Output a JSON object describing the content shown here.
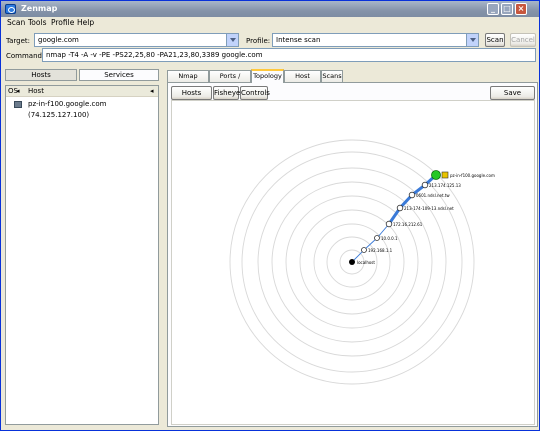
{
  "window": {
    "title": "Zenmap"
  },
  "menu": {
    "scan": "Scan",
    "tools": "Tools",
    "profile": "Profile",
    "help": "Help"
  },
  "target": {
    "label": "Target:",
    "value": "google.com"
  },
  "profile": {
    "label": "Profile:",
    "value": "Intense scan"
  },
  "buttons": {
    "scan": "Scan",
    "cancel": "Cancel"
  },
  "command": {
    "label": "Command:",
    "value": "nmap -T4 -A -v -PE -PS22,25,80 -PA21,23,80,3389 google.com"
  },
  "left_tabs": {
    "hosts": "Hosts",
    "services": "Services"
  },
  "host_list": {
    "col_os": "OS",
    "col_host": "Host",
    "rows": [
      {
        "host": "pz-in-f100.google.com (74.125.127.100)"
      }
    ]
  },
  "right_tabs": [
    "Nmap Output",
    "Ports / Hosts",
    "Topology",
    "Host Details",
    "Scans"
  ],
  "topology": {
    "hosts_viewer": "Hosts Viewer",
    "fisheye": "Fisheye",
    "controls": "Controls",
    "save_graphic": "Save Graphic",
    "nodes": [
      {
        "label": "localhost"
      },
      {
        "label": "192.168.1.1"
      },
      {
        "label": "10.0.0.1"
      },
      {
        "label": "172.16.212.61"
      },
      {
        "label": "213-174-109-13.ndsl.net"
      },
      {
        "label": "0601.ndsl.net.tw"
      },
      {
        "label": "213.174.125.13"
      },
      {
        "label": "pz-in-f100.google.com"
      }
    ],
    "colors": {
      "link": "#3a7ad8",
      "ring": "#d8d8d8",
      "target": "#26c826",
      "localhost": "#000000"
    }
  }
}
